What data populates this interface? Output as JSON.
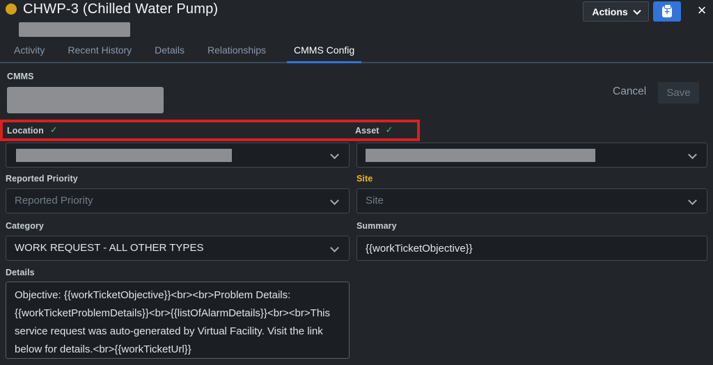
{
  "window": {
    "title": "CHWP-3 (Chilled Water Pump)",
    "close_glyph": "×",
    "actions_label": "Actions",
    "clipboard_plus_glyph": "+"
  },
  "tabs": [
    {
      "label": "Activity"
    },
    {
      "label": "Recent History"
    },
    {
      "label": "Details"
    },
    {
      "label": "Relationships"
    },
    {
      "label": "CMMS Config"
    }
  ],
  "toolbar": {
    "cancel_label": "Cancel",
    "save_label": "Save"
  },
  "form": {
    "cmms_label": "CMMS",
    "location": {
      "label": "Location",
      "check_glyph": "✓"
    },
    "asset": {
      "label": "Asset",
      "check_glyph": "✓"
    },
    "reported_priority": {
      "label": "Reported Priority",
      "placeholder": "Reported Priority"
    },
    "site": {
      "label": "Site",
      "placeholder": "Site"
    },
    "category": {
      "label": "Category",
      "value": "WORK REQUEST - ALL OTHER TYPES"
    },
    "summary": {
      "label": "Summary",
      "value": "{{workTicketObjective}}"
    },
    "details": {
      "label": "Details",
      "value": "Objective: {{workTicketObjective}}<br><br>Problem Details: {{workTicketProblemDetails}}<br>{{listOfAlarmDetails}}<br><br>This service request was auto-generated by Virtual Facility. Visit the link below for details.<br>{{workTicketUrl}}"
    }
  },
  "colors": {
    "accent_blue": "#3274d9",
    "annotation_red": "#dc1f1f",
    "valid_green": "#52c06e",
    "site_label_yellow": "#f6b50b",
    "status_dot_gold": "#d4a017",
    "redaction_gray": "#8d8e92"
  }
}
